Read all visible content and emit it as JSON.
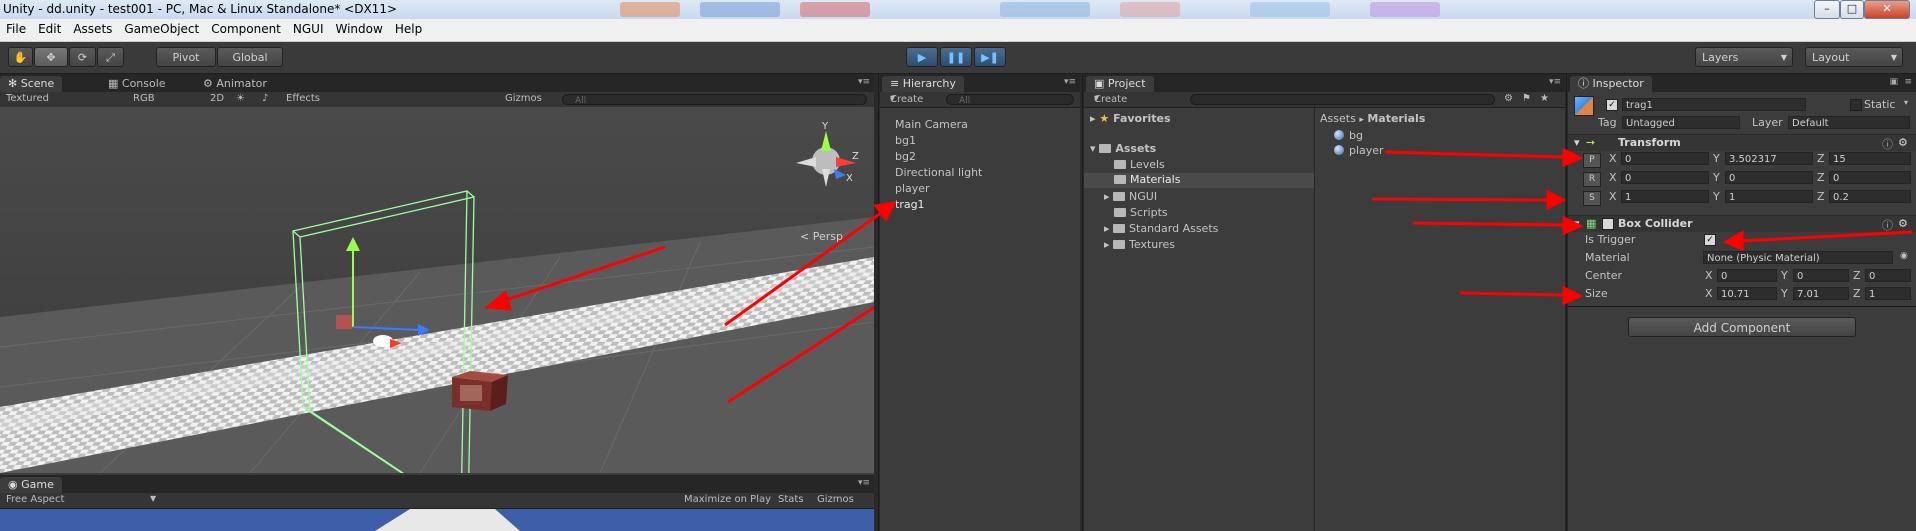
{
  "window": {
    "title": "Unity - dd.unity - test001 - PC, Mac & Linux Standalone* <DX11>"
  },
  "menu": [
    "File",
    "Edit",
    "Assets",
    "GameObject",
    "Component",
    "NGUI",
    "Window",
    "Help"
  ],
  "toolbar": {
    "pivot": "Pivot",
    "global": "Global",
    "layers": "Layers",
    "layout": "Layout"
  },
  "scene": {
    "tabs": [
      "Scene",
      "Console",
      "Animator"
    ],
    "bar": {
      "textured": "Textured",
      "rgb": "RGB",
      "twod": "2D",
      "effects": "Effects",
      "gizmos": "Gizmos",
      "search_placeholder": "All"
    },
    "persp": "Persp"
  },
  "game": {
    "tab": "Game",
    "aspect": "Free Aspect",
    "maximize": "Maximize on Play",
    "stats": "Stats",
    "gizmos": "Gizmos"
  },
  "hierarchy": {
    "tab": "Hierarchy",
    "create": "Create",
    "search_placeholder": "All",
    "items": [
      "Main Camera",
      "bg1",
      "bg2",
      "Directional light",
      "player",
      "trag1"
    ]
  },
  "project": {
    "tab": "Project",
    "create": "Create",
    "favorites": "Favorites",
    "assets": "Assets",
    "folders": [
      "Levels",
      "Materials",
      "NGUI",
      "Scripts",
      "Standard Assets",
      "Textures"
    ],
    "breadcrumb_root": "Assets",
    "breadcrumb_sep": "▸",
    "breadcrumb_leaf": "Materials",
    "files": [
      "bg",
      "player"
    ]
  },
  "inspector": {
    "tab": "Inspector",
    "object_name": "trag1",
    "static": "Static",
    "tag_label": "Tag",
    "tag_value": "Untagged",
    "layer_label": "Layer",
    "layer_value": "Default",
    "transform": {
      "title": "Transform",
      "p": "P",
      "r": "R",
      "s": "S",
      "position": {
        "x": "0",
        "y": "3.502317",
        "z": "15"
      },
      "rotation": {
        "x": "0",
        "y": "0",
        "z": "0"
      },
      "scale": {
        "x": "1",
        "y": "1",
        "z": "0.2"
      }
    },
    "box_collider": {
      "title": "Box Collider",
      "is_trigger": "Is Trigger",
      "material_label": "Material",
      "material_value": "None (Physic Material)",
      "center_label": "Center",
      "center": {
        "x": "0",
        "y": "0",
        "z": "0"
      },
      "size_label": "Size",
      "size": {
        "x": "10.71",
        "y": "7.01",
        "z": "1"
      }
    },
    "add_component": "Add Component"
  },
  "axes": {
    "x": "X",
    "y": "Y",
    "z": "Z"
  },
  "colors": {
    "accent": "#ff0000",
    "panel": "#3c3c3c",
    "toolbar": "#3a3a3a"
  }
}
